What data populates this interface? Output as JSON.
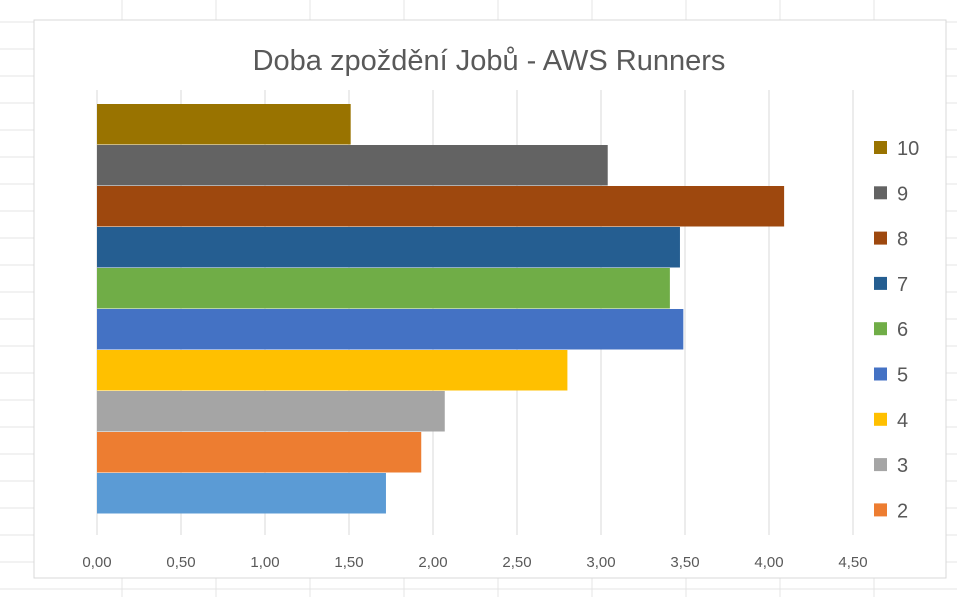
{
  "chart_data": {
    "type": "bar",
    "orientation": "horizontal",
    "title": "Doba zpoždění Jobů - AWS Runners",
    "xlabel": "",
    "ylabel": "",
    "xlim": [
      0,
      4.5
    ],
    "x_ticks": [
      "0,00",
      "0,50",
      "1,00",
      "1,50",
      "2,00",
      "2,50",
      "3,00",
      "3,50",
      "4,00",
      "4,50"
    ],
    "grid": "vertical",
    "legend_position": "right",
    "series": [
      {
        "name": "",
        "value": 1.72,
        "color": "#5B9BD5"
      },
      {
        "name": "2",
        "value": 1.93,
        "color": "#ED7D31"
      },
      {
        "name": "3",
        "value": 2.07,
        "color": "#A5A5A5"
      },
      {
        "name": "4",
        "value": 2.8,
        "color": "#FFC000"
      },
      {
        "name": "5",
        "value": 3.49,
        "color": "#4472C4"
      },
      {
        "name": "6",
        "value": 3.41,
        "color": "#70AD47"
      },
      {
        "name": "7",
        "value": 3.47,
        "color": "#255E91"
      },
      {
        "name": "8",
        "value": 4.09,
        "color": "#9E480E"
      },
      {
        "name": "9",
        "value": 3.04,
        "color": "#636363"
      },
      {
        "name": "10",
        "value": 1.51,
        "color": "#997300"
      }
    ]
  }
}
